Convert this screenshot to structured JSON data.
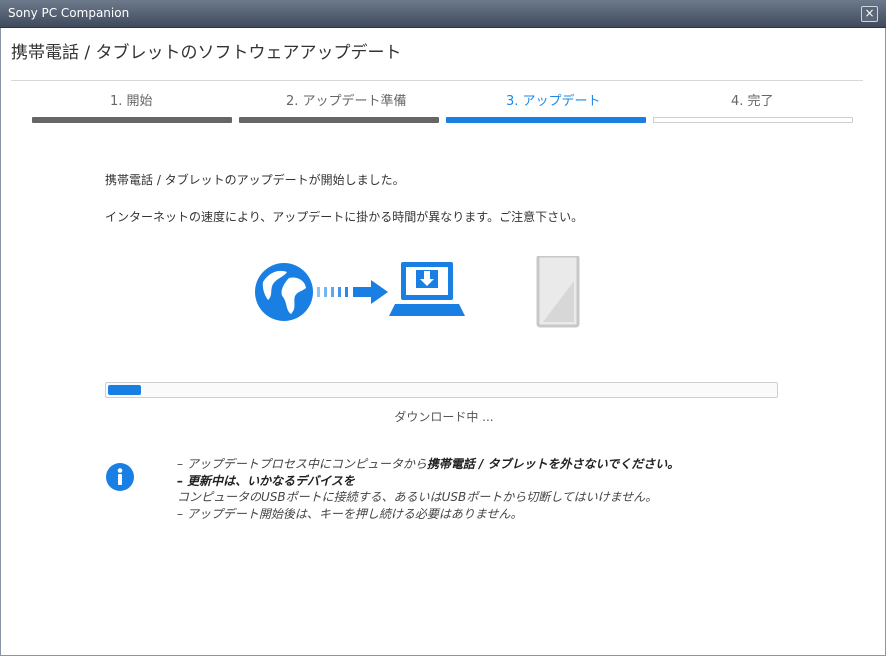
{
  "window": {
    "title": "Sony PC Companion",
    "close_glyph": "×"
  },
  "page": {
    "heading": "携帯電話 / タブレットのソフトウェアアップデート"
  },
  "steps": [
    {
      "label": "1. 開始",
      "state": "done"
    },
    {
      "label": "2. アップデート準備",
      "state": "done"
    },
    {
      "label": "3. アップデート",
      "state": "active"
    },
    {
      "label": "4. 完了",
      "state": "pending"
    }
  ],
  "messages": {
    "started": "携帯電話 / タブレットのアップデートが開始しました。",
    "speed_note": "インターネットの速度により、アップデートに掛かる時間が異なります。ご注意下さい。"
  },
  "illustration": {
    "source_icon": "globe-icon",
    "transfer_icon": "arrow-right-icon",
    "computer_icon": "laptop-download-icon",
    "device_icon": "phone-icon"
  },
  "progress": {
    "fraction": 0.05,
    "status_text": "ダウンロード中 ..."
  },
  "notes": {
    "icon": "info-icon",
    "line1_prefix": "– アップデートプロセス中にコンピュータから",
    "line1_bold": "携帯電話 / タブレットを外さないでください。",
    "line2_bold": "– 更新中は、いかなるデバイスを",
    "line3": "コンピュータのUSBポートに接続する、あるいはUSBポートから切断してはいけません。",
    "line4": "– アップデート開始後は、キーを押し続ける必要はありません。"
  },
  "colors": {
    "accent": "#1a7fe3",
    "done_bar": "#666666",
    "active_text": "#1e88e5"
  }
}
